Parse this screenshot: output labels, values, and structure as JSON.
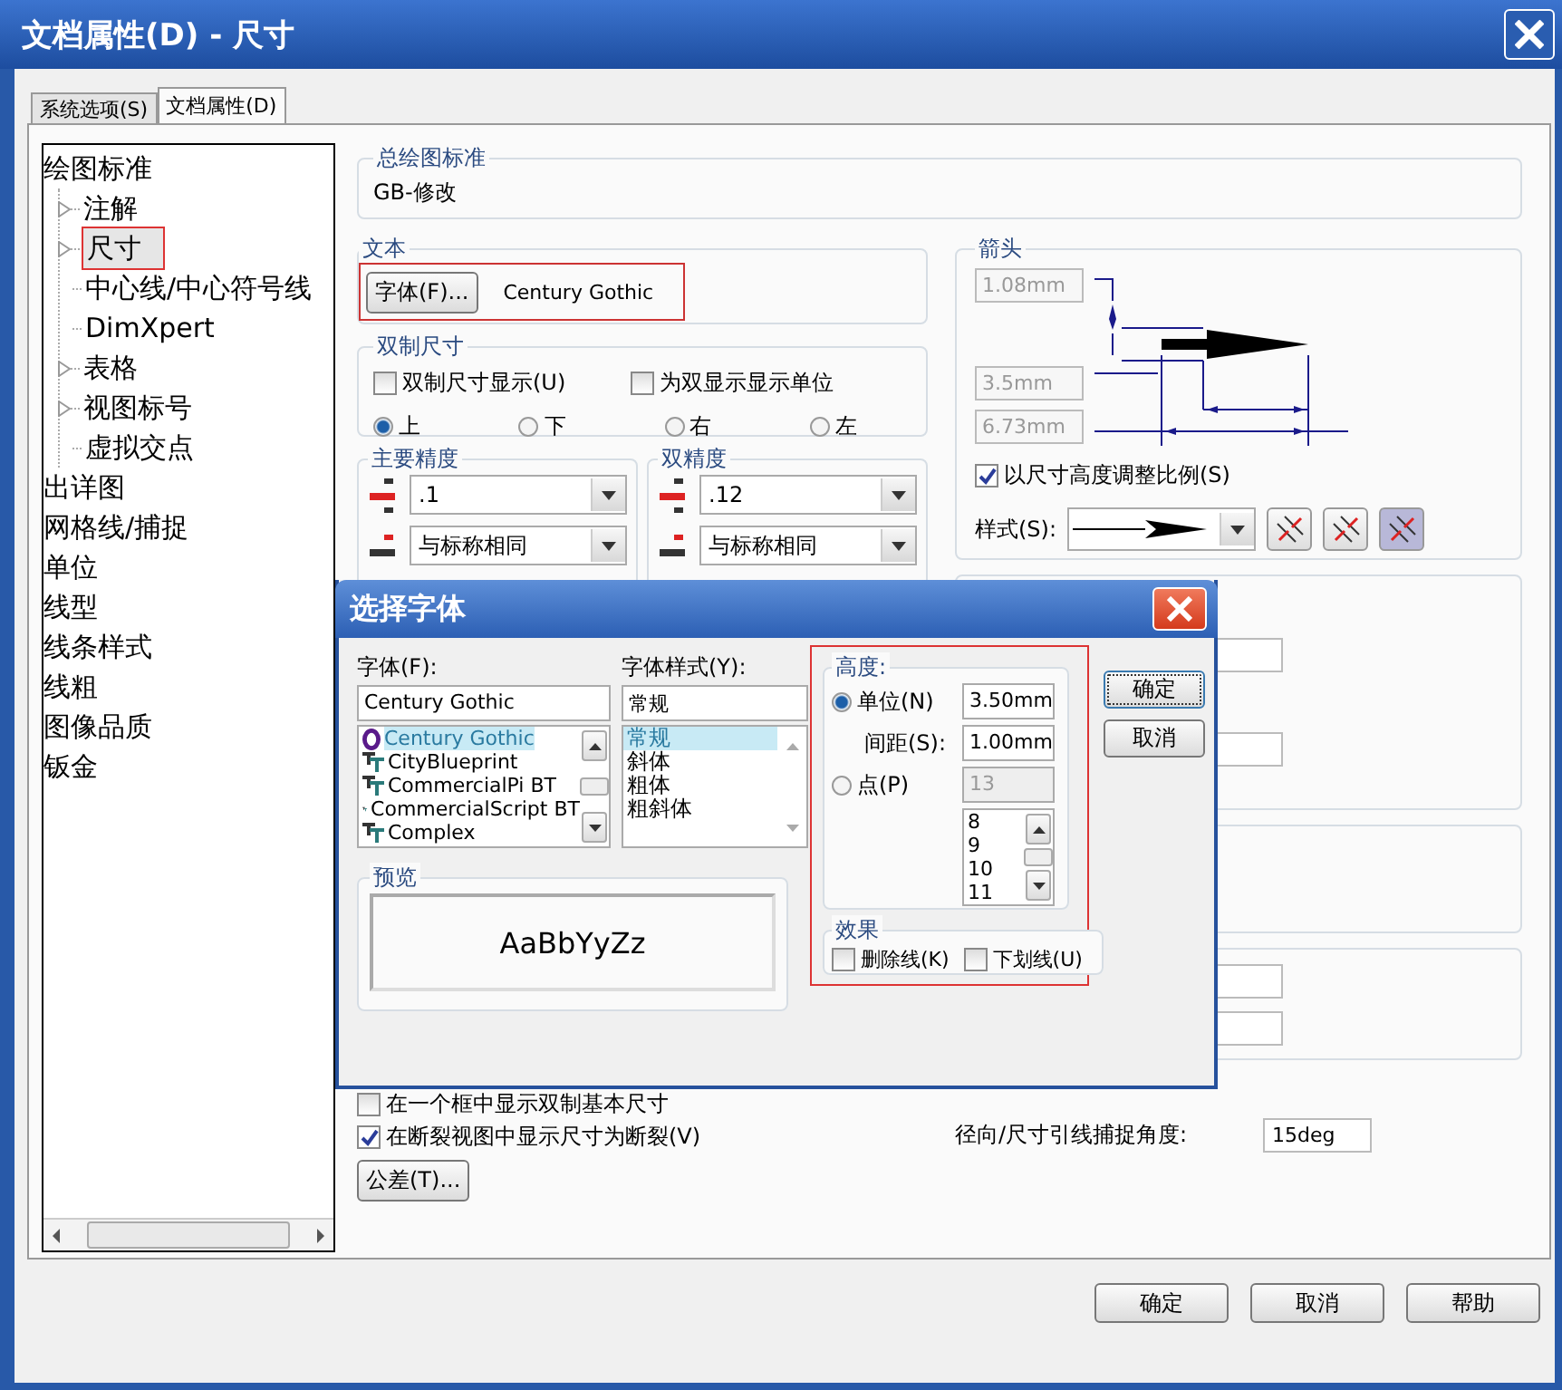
{
  "window": {
    "title": "文档属性(D) - 尺寸"
  },
  "tabs": [
    {
      "label": "系统选项(S)",
      "selected": false
    },
    {
      "label": "文档属性(D)",
      "selected": true
    }
  ],
  "tree": [
    {
      "label": "绘图标准",
      "selected": false,
      "children": [
        {
          "label": "注解",
          "expandable": true,
          "selected": false
        },
        {
          "label": "尺寸",
          "expandable": true,
          "selected": true
        },
        {
          "label": "中心线/中心符号线",
          "expandable": false,
          "selected": false
        },
        {
          "label": "DimXpert",
          "expandable": false,
          "selected": false
        },
        {
          "label": "表格",
          "expandable": true,
          "selected": false
        },
        {
          "label": "视图标号",
          "expandable": true,
          "selected": false
        },
        {
          "label": "虚拟交点",
          "expandable": false,
          "selected": false
        }
      ]
    },
    {
      "label": "出详图",
      "selected": false
    },
    {
      "label": "网格线/捕捉",
      "selected": false
    },
    {
      "label": "单位",
      "selected": false
    },
    {
      "label": "线型",
      "selected": false
    },
    {
      "label": "线条样式",
      "selected": false
    },
    {
      "label": "线粗",
      "selected": false
    },
    {
      "label": "图像品质",
      "selected": false
    },
    {
      "label": "钣金",
      "selected": false
    }
  ],
  "overall_standard": {
    "title": "总绘图标准",
    "value": "GB-修改"
  },
  "text_group": {
    "title": "文本",
    "font_button": "字体(F)...",
    "font_name": "Century Gothic"
  },
  "dual_dimension": {
    "title": "双制尺寸",
    "checkboxes": [
      {
        "label": "双制尺寸显示(U)",
        "checked": false
      },
      {
        "label": "为双显示显示单位",
        "checked": false
      }
    ],
    "positions": [
      {
        "label": "上",
        "selected": true
      },
      {
        "label": "下",
        "selected": false
      },
      {
        "label": "右",
        "selected": false
      },
      {
        "label": "左",
        "selected": false
      }
    ]
  },
  "precision": [
    {
      "title": "主要精度",
      "value": ".1",
      "tolerance": "与标称相同"
    },
    {
      "title": "双精度",
      "value": ".12",
      "tolerance": "与标称相同"
    }
  ],
  "arrows": {
    "title": "箭头",
    "fields": [
      {
        "value": "1.08mm",
        "disabled": true
      },
      {
        "value": "3.5mm",
        "disabled": true
      },
      {
        "value": "6.73mm",
        "disabled": true
      }
    ],
    "scale_checkbox": {
      "label": "以尺寸高度调整比例(S)",
      "checked": true
    },
    "style_label": "样式(S):",
    "style_buttons": [
      {
        "selected": false
      },
      {
        "selected": false
      },
      {
        "selected": true
      }
    ]
  },
  "options": [
    {
      "label": "在一个框中显示双制基本尺寸",
      "checked": false
    },
    {
      "label": "在断裂视图中显示尺寸为断裂(V)",
      "checked": true
    }
  ],
  "tolerance_button": "公差(T)...",
  "snap_angle": {
    "label": "径向/尺寸引线捕捉角度:",
    "value": "15deg"
  },
  "buttons": [
    "确定",
    "取消",
    "帮助"
  ],
  "font_dialog": {
    "title": "选择字体",
    "font_label": "字体(F):",
    "font_value": "Century Gothic",
    "fonts": [
      {
        "name": "Century Gothic",
        "kind": "opentype",
        "selected": true
      },
      {
        "name": "CityBlueprint",
        "kind": "truetype",
        "selected": false
      },
      {
        "name": "CommercialPi BT",
        "kind": "truetype",
        "selected": false
      },
      {
        "name": "CommercialScript BT",
        "kind": "truetype",
        "selected": false
      },
      {
        "name": "Complex",
        "kind": "truetype",
        "selected": false
      }
    ],
    "style_label": "字体样式(Y):",
    "style_value": "常规",
    "styles": [
      {
        "label": "常规",
        "selected": true
      },
      {
        "label": "斜体",
        "selected": false
      },
      {
        "label": "粗体",
        "selected": false
      },
      {
        "label": "粗斜体",
        "selected": false
      }
    ],
    "preview_title": "预览",
    "preview_text": "AaBbYyZz",
    "height": {
      "title": "高度:",
      "units": {
        "label": "单位(N)",
        "selected": true,
        "value": "3.50mm"
      },
      "spacing": {
        "label": "间距(S):",
        "value": "1.00mm"
      },
      "points": {
        "label": "点(P)",
        "selected": false,
        "value": "13",
        "disabled": true
      },
      "sizes": [
        "8",
        "9",
        "10",
        "11"
      ]
    },
    "effects": {
      "title": "效果",
      "options": [
        {
          "label": "删除线(K)",
          "checked": false
        },
        {
          "label": "下划线(U)",
          "checked": false
        }
      ]
    },
    "buttons": [
      "确定",
      "取消"
    ]
  }
}
